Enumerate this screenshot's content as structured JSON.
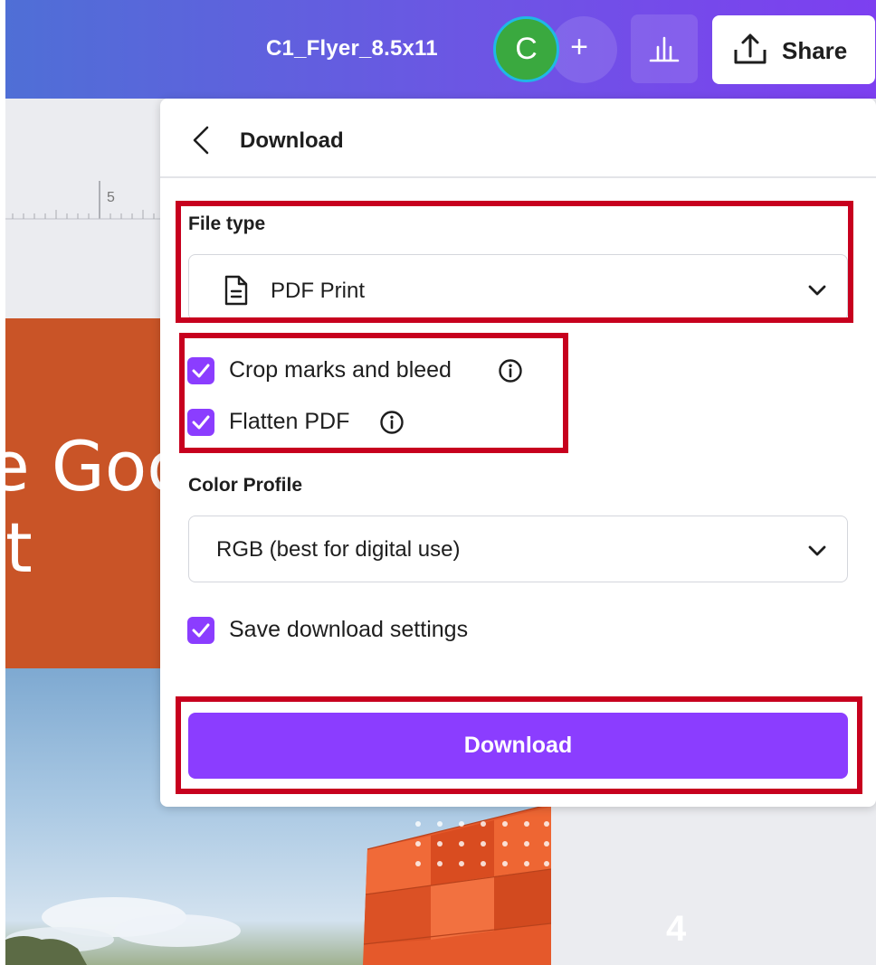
{
  "topbar": {
    "document_title": "C1_Flyer_8.5x11",
    "avatar_initial": "C",
    "add_collaborator_symbol": "+",
    "insights_icon": "bar-chart-icon",
    "share_label": "Share",
    "share_icon": "upload-icon"
  },
  "canvas": {
    "ruler_label": "5",
    "headline_line1": "e Goo",
    "headline_line2": "t",
    "page_number": "4"
  },
  "download_panel": {
    "title": "Download",
    "back_icon": "chevron-left-icon",
    "file_type": {
      "label": "File type",
      "selected": "PDF Print",
      "icon": "document-icon"
    },
    "options": [
      {
        "label": "Crop marks and bleed",
        "checked": true,
        "has_info": true
      },
      {
        "label": "Flatten PDF",
        "checked": true,
        "has_info": true
      }
    ],
    "color_profile": {
      "label": "Color Profile",
      "selected": "RGB (best for digital use)"
    },
    "save_settings": {
      "label": "Save download settings",
      "checked": true
    },
    "download_button_label": "Download"
  },
  "colors": {
    "accent": "#8b3dff",
    "highlight": "#c7001e",
    "topbar_start": "#4f6fd6",
    "topbar_end": "#7d3ff0",
    "canvas_orange": "#c95427",
    "avatar_green": "#3aa93f"
  }
}
